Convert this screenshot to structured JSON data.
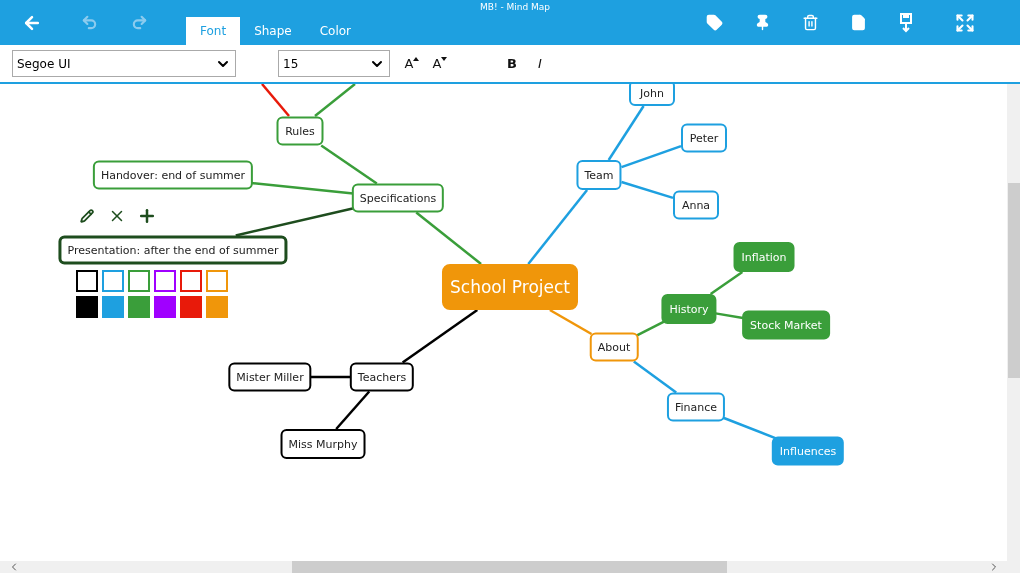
{
  "window": {
    "title": "MB! - Mind Map"
  },
  "tabs": [
    {
      "label": "Font",
      "selected": true
    },
    {
      "label": "Shape",
      "selected": false
    },
    {
      "label": "Color",
      "selected": false
    }
  ],
  "toolbar": {
    "font": "Segoe UI",
    "size": "15",
    "grow": "A",
    "shrink": "A",
    "bold": "B",
    "italic": "I"
  },
  "mindmap": {
    "root": {
      "text": "School Project",
      "color": "#f0960a",
      "filled": true,
      "selected": false,
      "children": [
        {
          "text": "Specifications",
          "color": "#3a9e3a",
          "filled": false,
          "selected": false,
          "children": [
            {
              "text": "Rules",
              "color": "#3a9e3a",
              "filled": false,
              "selected": false
            },
            {
              "text": "Handover: end of summer",
              "color": "#3a9e3a",
              "filled": false,
              "selected": false
            },
            {
              "text": "Presentation: after the end of summer",
              "color": "#1e4d1e",
              "filled": false,
              "selected": true
            }
          ]
        },
        {
          "text": "Teachers",
          "color": "#000000",
          "filled": false,
          "selected": false,
          "children": [
            {
              "text": "Mister Miller",
              "color": "#000000",
              "filled": false,
              "selected": false
            },
            {
              "text": "Miss Murphy",
              "color": "#000000",
              "filled": false,
              "selected": false
            }
          ]
        },
        {
          "text": "Team",
          "color": "#1ea0e0",
          "filled": false,
          "selected": false,
          "children": [
            {
              "text": "John",
              "color": "#1ea0e0",
              "filled": false,
              "selected": false
            },
            {
              "text": "Peter",
              "color": "#1ea0e0",
              "filled": false,
              "selected": false
            },
            {
              "text": "Anna",
              "color": "#1ea0e0",
              "filled": false,
              "selected": false
            }
          ]
        },
        {
          "text": "About",
          "color": "#f0960a",
          "filled": false,
          "selected": false,
          "children": [
            {
              "text": "History",
              "color": "#3a9e3a",
              "filled": true,
              "selected": false,
              "children": [
                {
                  "text": "Inflation",
                  "color": "#3a9e3a",
                  "filled": true,
                  "selected": false
                },
                {
                  "text": "Stock Market",
                  "color": "#3a9e3a",
                  "filled": true,
                  "selected": false
                }
              ]
            },
            {
              "text": "Finance",
              "color": "#1ea0e0",
              "filled": false,
              "selected": false,
              "children": [
                {
                  "text": "Influences",
                  "color": "#1ea0e0",
                  "filled": true,
                  "selected": false
                }
              ]
            }
          ]
        }
      ]
    }
  },
  "palette": [
    {
      "color": "#000000"
    },
    {
      "color": "#1ea0e0"
    },
    {
      "color": "#3a9e3a"
    },
    {
      "color": "#a000ff"
    },
    {
      "color": "#e81a0a"
    },
    {
      "color": "#f0960a"
    }
  ]
}
